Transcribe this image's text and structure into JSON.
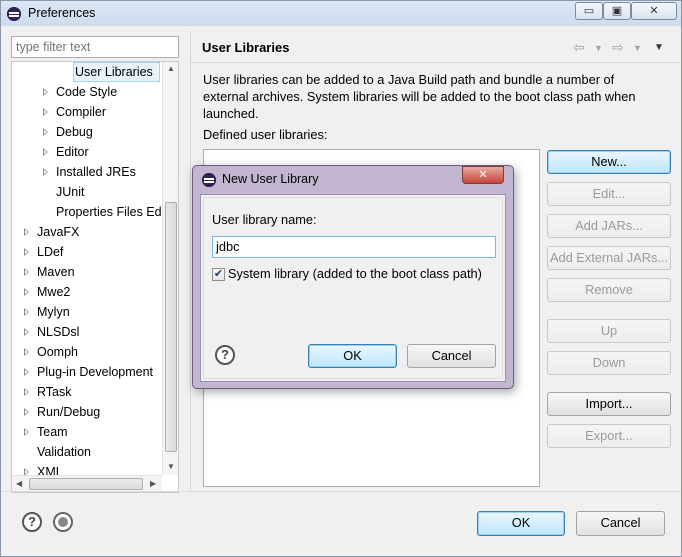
{
  "window": {
    "title": "Preferences"
  },
  "window_buttons": {
    "minimize": "▭",
    "maximize": "▣",
    "close": "✕"
  },
  "filter": {
    "placeholder": "type filter text"
  },
  "tree": {
    "items": [
      {
        "label": "User Libraries",
        "level": 2,
        "expandable": false,
        "selected": true
      },
      {
        "label": "Code Style",
        "level": 1,
        "expandable": true
      },
      {
        "label": "Compiler",
        "level": 1,
        "expandable": true
      },
      {
        "label": "Debug",
        "level": 1,
        "expandable": true
      },
      {
        "label": "Editor",
        "level": 1,
        "expandable": true
      },
      {
        "label": "Installed JREs",
        "level": 1,
        "expandable": true
      },
      {
        "label": "JUnit",
        "level": 1,
        "expandable": false
      },
      {
        "label": "Properties Files Ed",
        "level": 1,
        "expandable": false
      },
      {
        "label": "JavaFX",
        "level": 0,
        "expandable": true
      },
      {
        "label": "LDef",
        "level": 0,
        "expandable": true
      },
      {
        "label": "Maven",
        "level": 0,
        "expandable": true
      },
      {
        "label": "Mwe2",
        "level": 0,
        "expandable": true
      },
      {
        "label": "Mylyn",
        "level": 0,
        "expandable": true
      },
      {
        "label": "NLSDsl",
        "level": 0,
        "expandable": true
      },
      {
        "label": "Oomph",
        "level": 0,
        "expandable": true
      },
      {
        "label": "Plug-in Development",
        "level": 0,
        "expandable": true
      },
      {
        "label": "RTask",
        "level": 0,
        "expandable": true
      },
      {
        "label": "Run/Debug",
        "level": 0,
        "expandable": true
      },
      {
        "label": "Team",
        "level": 0,
        "expandable": true
      },
      {
        "label": "Validation",
        "level": 0,
        "expandable": false
      },
      {
        "label": "XML",
        "level": 0,
        "expandable": true
      }
    ]
  },
  "page": {
    "title": "User Libraries",
    "description": "User libraries can be added to a Java Build path and bundle a number of external archives. System libraries will be added to the boot class path when launched.",
    "defined_label": "Defined user libraries:"
  },
  "buttons": {
    "new": "New...",
    "edit": "Edit...",
    "add_jars": "Add JARs...",
    "add_external_jars": "Add External JARs...",
    "remove": "Remove",
    "up": "Up",
    "down": "Down",
    "import": "Import...",
    "export": "Export..."
  },
  "footer": {
    "ok": "OK",
    "cancel": "Cancel",
    "help": "?"
  },
  "dialog": {
    "title": "New User Library",
    "close": "✕",
    "name_label": "User library name:",
    "name_value": "jdbc",
    "system_checkbox_label": "System library (added to the boot class path)",
    "system_checked": true,
    "ok": "OK",
    "cancel": "Cancel",
    "help": "?"
  },
  "colors": {
    "selection": "#e8f2fb",
    "focus_border": "#3c7fb1"
  }
}
